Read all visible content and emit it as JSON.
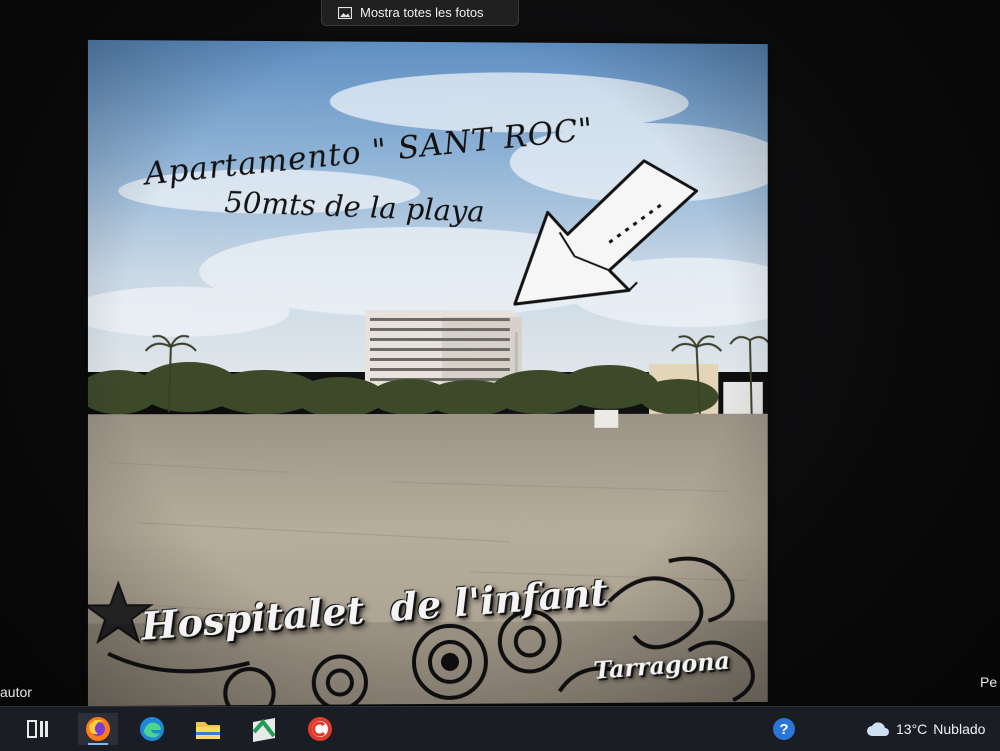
{
  "photos_app": {
    "show_all_label": "Mostra totes les fotos",
    "show_all_icon": "photo-gallery-icon"
  },
  "poster": {
    "headline_line1": "Apartamento \" SANT ROC\"",
    "headline_line2": "50mts de la playa",
    "town": "Hospitalet  de l'infant",
    "province": "Tarragona"
  },
  "edge_text": {
    "left": "autor",
    "right": "Pe"
  },
  "taskbar": {
    "items": [
      {
        "name": "task-view-icon"
      },
      {
        "name": "firefox-icon"
      },
      {
        "name": "edge-icon"
      },
      {
        "name": "file-explorer-icon"
      },
      {
        "name": "maps-app-icon"
      },
      {
        "name": "ccleaner-icon"
      },
      {
        "name": "help-icon"
      }
    ],
    "weather": {
      "icon": "cloud-icon",
      "temperature": "13°C",
      "condition": "Nublado"
    }
  }
}
